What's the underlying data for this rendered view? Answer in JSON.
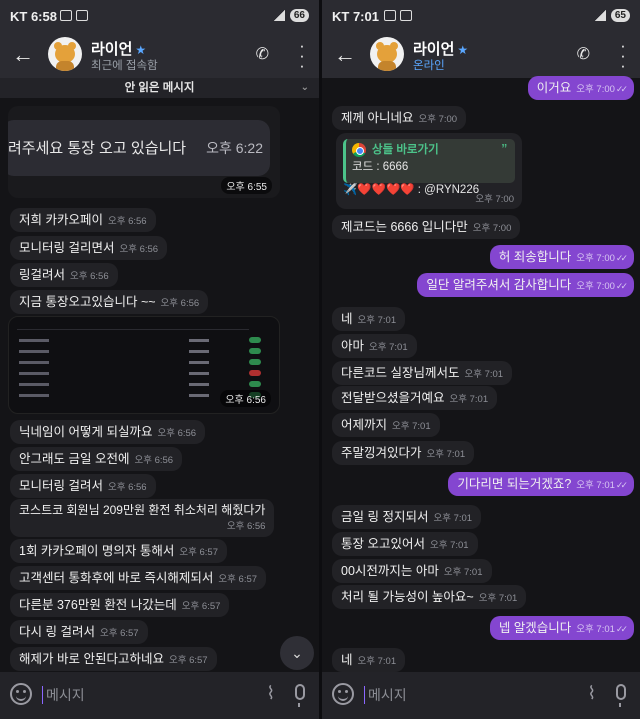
{
  "left": {
    "status": {
      "time": "KT 6:58",
      "battery": "66"
    },
    "header": {
      "name": "라이언",
      "subtitle": "최근에 접속함"
    },
    "unread_banner": "안 읽은 메시지",
    "image1": {
      "text": "려주세요 통장 오고 있습니다",
      "inner_time": "오후 6:22",
      "time": "오후 6:55"
    },
    "msgs1": [
      {
        "text": "저희 카카오페이",
        "time": "오후 6:56"
      },
      {
        "text": "모니터링 걸리면서",
        "time": "오후 6:56"
      },
      {
        "text": "링걸려서",
        "time": "오후 6:56"
      },
      {
        "text": "지금 통장오고있습니다 ~~",
        "time": "오후 6:56"
      }
    ],
    "image2": {
      "time": "오후 6:56"
    },
    "msgs2": [
      {
        "text": "닉네임이 어떻게 되실까요",
        "time": "오후 6:56"
      },
      {
        "text": "안그래도 금일 오전에",
        "time": "오후 6:56"
      },
      {
        "text": "모니터링 걸려서",
        "time": "오후 6:56"
      },
      {
        "text": "코스트코 회원님 209만원 환전 취소처리 해줬다가",
        "time": "오후 6:56"
      },
      {
        "text": "1회 카카오페이 명의자 통해서",
        "time": "오후 6:57"
      },
      {
        "text": "고객센터 통화후에 바로 즉시해제되서",
        "time": "오후 6:57"
      },
      {
        "text": "다른분 376만원 환전 나갔는데",
        "time": "오후 6:57"
      },
      {
        "text": "다시 링 걸려서",
        "time": "오후 6:57"
      },
      {
        "text": "해제가 바로 안된다고하네요",
        "time": "오후 6:57"
      }
    ],
    "input_placeholder": "메시지"
  },
  "right": {
    "status": {
      "time": "KT 7:01",
      "battery": "65"
    },
    "header": {
      "name": "라이언",
      "subtitle": "온라인"
    },
    "msgs_top": [
      {
        "text": "이거요",
        "time": "오후 7:00",
        "out": true
      },
      {
        "text": "제께 아니네요",
        "time": "오후 7:00",
        "out": false
      }
    ],
    "card": {
      "title": "상들 바로가기",
      "line1": "코드 : 6666",
      "line2": "✈️❤️❤️❤️❤️ : @RYN226",
      "time": "오후 7:00"
    },
    "msgs": [
      {
        "text": "제코드는 6666 입니다만",
        "time": "오후 7:00",
        "out": false
      },
      {
        "text": "허 죄송합니다",
        "time": "오후 7:00",
        "out": true
      },
      {
        "text": "일단 알려주셔서 감사합니다",
        "time": "오후 7:00",
        "out": true
      },
      {
        "text": "네",
        "time": "오후 7:01",
        "out": false
      },
      {
        "text": "아마",
        "time": "오후 7:01",
        "out": false
      },
      {
        "text": "다른코드 실장님께서도",
        "time": "오후 7:01",
        "out": false
      },
      {
        "text": "전달받으셨을거예요",
        "time": "오후 7:01",
        "out": false
      },
      {
        "text": "어제까지",
        "time": "오후 7:01",
        "out": false
      },
      {
        "text": "주말낑겨있다가",
        "time": "오후 7:01",
        "out": false
      },
      {
        "text": "기다리면 되는거겠죠?",
        "time": "오후 7:01",
        "out": true
      },
      {
        "text": "금일 링 정지되서",
        "time": "오후 7:01",
        "out": false
      },
      {
        "text": "통장 오고있어서",
        "time": "오후 7:01",
        "out": false
      },
      {
        "text": "00시전까지는 아마",
        "time": "오후 7:01",
        "out": false
      },
      {
        "text": "처리 될 가능성이 높아요~",
        "time": "오후 7:01",
        "out": false
      },
      {
        "text": "넵 알겠습니다",
        "time": "오후 7:01",
        "out": true
      },
      {
        "text": "네",
        "time": "오후 7:01",
        "out": false
      }
    ],
    "input_placeholder": "메시지"
  }
}
